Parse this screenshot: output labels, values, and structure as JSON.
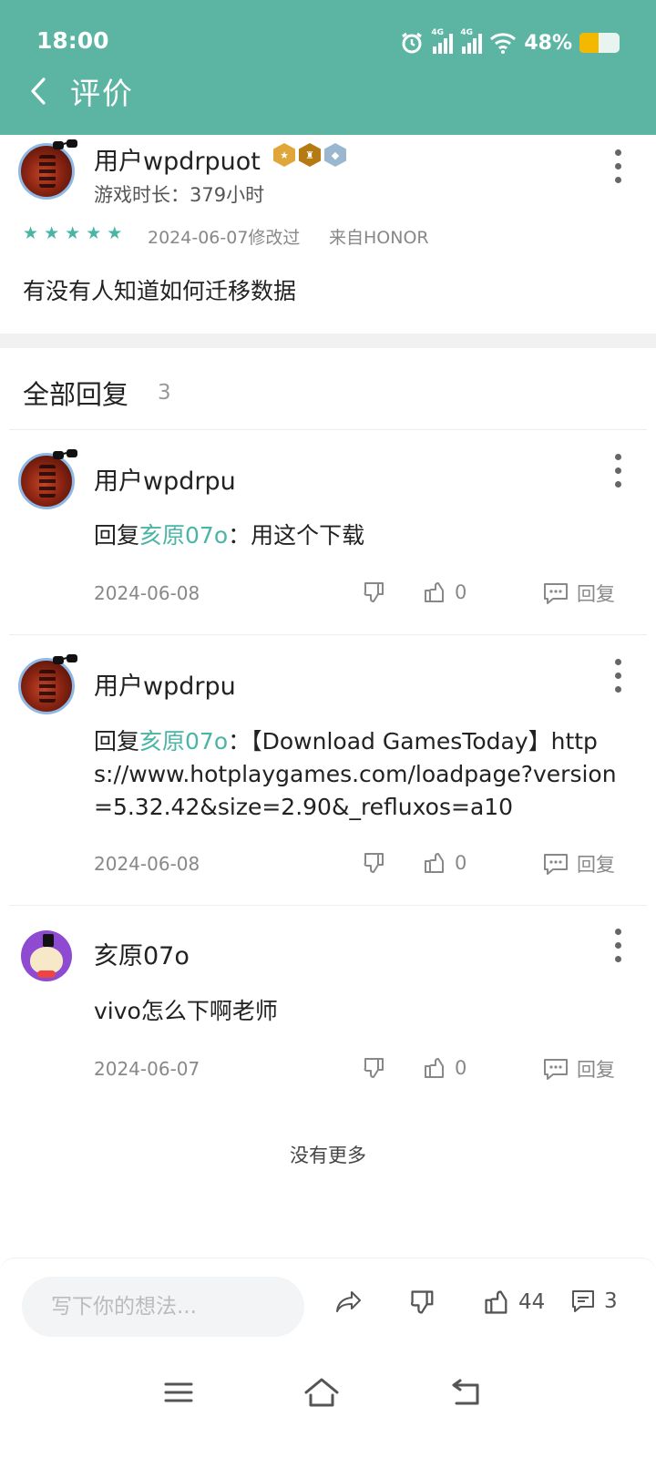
{
  "status_bar": {
    "time": "18:00",
    "network_1": "4G",
    "network_2": "4G",
    "battery": "48%",
    "battery_level": 0.48,
    "battery_color": "#f5b800"
  },
  "header": {
    "title": "评价",
    "background_color": "#5bb5a2",
    "back_icon": "chevron-left-icon"
  },
  "review": {
    "user": "用户wpdrpuot",
    "playtime_label": "游戏时长：",
    "playtime_value": "379小时",
    "stars": "★ ★ ★ ★ ★",
    "rating": 5,
    "date": "2024-06-07修改过",
    "source": "来自HONOR",
    "text": "有没有人知道如何迁移数据"
  },
  "replies_section": {
    "title": "全部回复",
    "count": "3"
  },
  "replies": [
    {
      "user": "用户wpdrpu",
      "prefix": "回复",
      "mention": "亥原07o",
      "colon": "：",
      "body": "用这个下载",
      "date": "2024-06-08",
      "likes": "0",
      "reply_label": "回复"
    },
    {
      "user": "用户wpdrpu",
      "prefix": "回复",
      "mention": "亥原07o",
      "colon": "：",
      "body": "【Download GamesToday】https://www.hotplaygames.com/loadpage?version=5.32.42&size=2.90&_refluxos=a10",
      "date": "2024-06-08",
      "likes": "0",
      "reply_label": "回复"
    },
    {
      "user": "亥原07o",
      "body": "vivo怎么下啊老师",
      "date": "2024-06-07",
      "likes": "0",
      "reply_label": "回复"
    }
  ],
  "no_more": "没有更多",
  "bottom_bar": {
    "input_placeholder": "写下你的想法...",
    "likes": "44",
    "comments": "3"
  },
  "accent_color": "#4bb5a5"
}
